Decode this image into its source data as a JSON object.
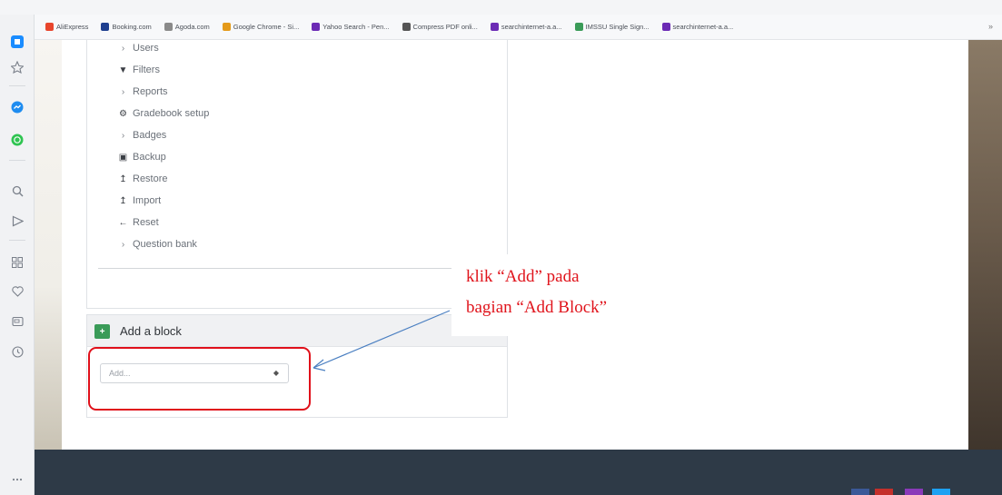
{
  "bookmarks": [
    {
      "label": "AliExpress",
      "color": "#e8452c"
    },
    {
      "label": "Booking.com",
      "color": "#1e3f8f"
    },
    {
      "label": "Agoda.com",
      "color": "#8a8a8a"
    },
    {
      "label": "Google Chrome - Si...",
      "color": "#e49a1a"
    },
    {
      "label": "Yahoo Search - Pen...",
      "color": "#6c2bb5"
    },
    {
      "label": "Compress PDF onli...",
      "color": "#555555"
    },
    {
      "label": "searchinternet-a.a...",
      "color": "#6c2bb5"
    },
    {
      "label": "IMSSU Single Sign...",
      "color": "#3a9b58"
    },
    {
      "label": "searchinternet-a.a...",
      "color": "#6c2bb5"
    }
  ],
  "bookmarks_more": "»",
  "sidebar_icons": [
    "home-icon",
    "star-icon",
    "messenger-icon",
    "whatsapp-icon",
    "search-icon",
    "send-icon",
    "apps-icon",
    "heart-icon",
    "wallet-icon",
    "history-icon",
    "more-icon"
  ],
  "admin_nav": [
    {
      "label": "Users",
      "icon": "chevron-right-icon",
      "glyph": "›"
    },
    {
      "label": "Filters",
      "icon": "filter-icon",
      "glyph": "▼"
    },
    {
      "label": "Reports",
      "icon": "chevron-right-icon",
      "glyph": "›"
    },
    {
      "label": "Gradebook setup",
      "icon": "gear-icon",
      "glyph": "⚙"
    },
    {
      "label": "Badges",
      "icon": "chevron-right-icon",
      "glyph": "›"
    },
    {
      "label": "Backup",
      "icon": "backup-icon",
      "glyph": "▣"
    },
    {
      "label": "Restore",
      "icon": "restore-icon",
      "glyph": "↥"
    },
    {
      "label": "Import",
      "icon": "import-icon",
      "glyph": "↥"
    },
    {
      "label": "Reset",
      "icon": "reset-arrow-icon",
      "glyph": "←"
    },
    {
      "label": "Question bank",
      "icon": "chevron-right-icon",
      "glyph": "›"
    }
  ],
  "add_block": {
    "title": "Add a block",
    "select_placeholder": "Add...",
    "accent": "#3a9b58"
  },
  "annotation": {
    "line1": "klik   “Add”   pada",
    "line2": "bagian “Add Block”",
    "color": "#e0141c"
  }
}
